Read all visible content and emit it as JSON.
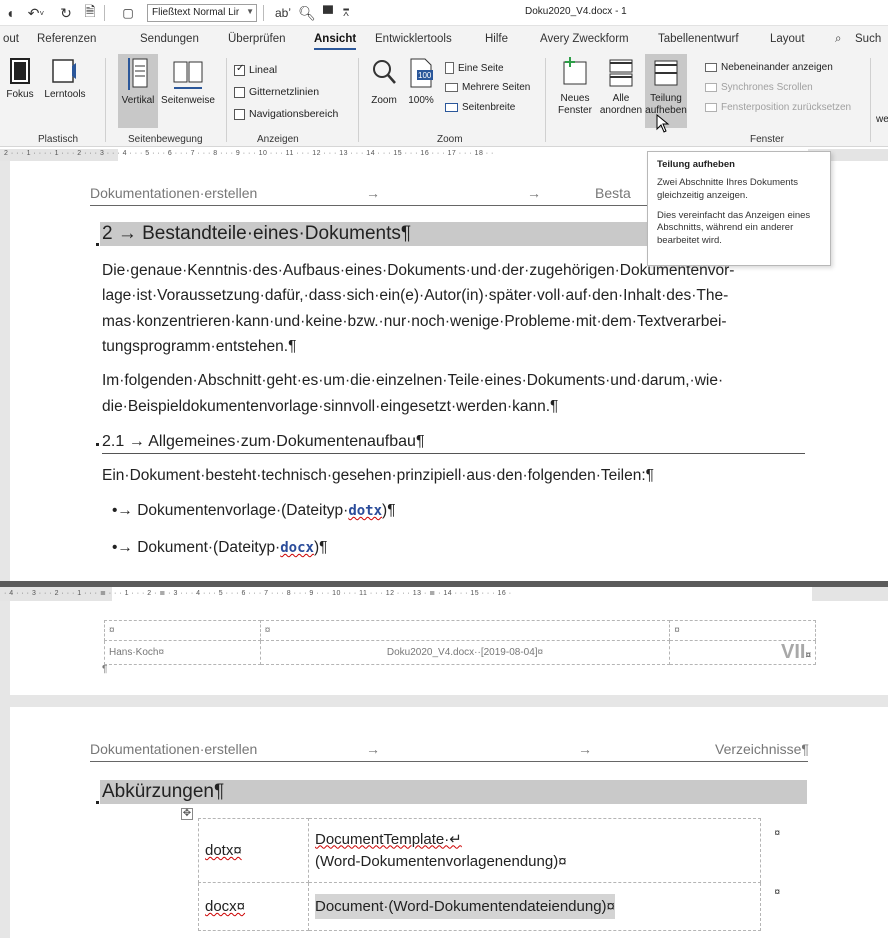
{
  "titlebar": {
    "style_name": "Fließtext Normal Lir",
    "doc_title": "Doku2020_V4.docx  -  1"
  },
  "tabs": [
    "out",
    "Referenzen",
    "Sendungen",
    "Überprüfen",
    "Ansicht",
    "Entwicklertools",
    "Hilfe",
    "Avery Zweckform",
    "Tabellenentwurf",
    "Layout",
    "Such"
  ],
  "active_tab": "Ansicht",
  "ribbon": {
    "fokus": "Fokus",
    "lerntools": "Lerntools",
    "plastisch_label": "Plastisch",
    "vertikal": "Vertikal",
    "seitenweise": "Seitenweise",
    "seitenbewegung_label": "Seitenbewegung",
    "lineal": "Lineal",
    "lineal_checked": true,
    "gitternetzlinien": "Gitternetzlinien",
    "navigationsbereich": "Navigationsbereich",
    "anzeigen_label": "Anzeigen",
    "zoom": "Zoom",
    "zoom100": "100%",
    "eine_seite": "Eine Seite",
    "mehrere_seiten": "Mehrere Seiten",
    "seitenbreite": "Seitenbreite",
    "zoom_label": "Zoom",
    "neues_fenster_1": "Neues",
    "neues_fenster_2": "Fenster",
    "alle_anordnen_1": "Alle",
    "alle_anordnen_2": "anordnen",
    "teilung_1": "Teilung",
    "teilung_2": "aufheben",
    "nebeneinander": "Nebeneinander anzeigen",
    "synchrones": "Synchrones Scrollen",
    "fensterposition": "Fensterposition zurücksetzen",
    "fenster_label": "Fenster",
    "edge_text": "we"
  },
  "tooltip": {
    "title": "Teilung aufheben",
    "p1": "Zwei Abschnitte Ihres Dokuments gleichzeitig anzeigen.",
    "p2": "Dies vereinfacht das Anzeigen eines Abschnitts, während ein anderer bearbeitet wird."
  },
  "rulers": {
    "top": "2 · · · 1 · · ·      · 1 · · · 2 · · · 3 · · · 4 · · · 5 · · · 6 · · · 7 · · · 8 · · · 9 · · · 10 · · · 11 · · · 12 · · · 13 · · · 14 · · · 15 · · · 16 · · · 17 · · · 18 · ·",
    "split": "· 4 · · · 3 · · · 2 · · · 1 · · · ≣ · · · 1 · · · 2 · ≣ · 3 · · · 4 · · · 5 · · · 6 · · · 7 · · · 8 · · · 9 · · · 10 · · · 11 · · · 12 · · · 13 · ≣ · 14 · · · 15 · · · 16 ·"
  },
  "doc1": {
    "header_left": "Dokumentationen·erstellen",
    "header_arrow1": "→",
    "header_arrow2": "→",
    "header_right": "Besta",
    "h1": "2 → Bestandteile·eines·Dokuments¶",
    "para1": [
      "Die·genaue·Kenntnis·des·Aufbaus·eines·Dokuments·und·der·zugehörigen·Dokumentenvor-",
      "lage·ist·Voraussetzung·dafür,·dass·sich·ein(e)·Autor(in)·später·voll·auf·den·Inhalt·des·The-",
      "mas·konzentrieren·kann·und·keine·bzw.·nur·noch·wenige·Probleme·mit·dem·Textverarbei-",
      "tungsprogramm·entstehen.¶"
    ],
    "para2": [
      "Im·folgenden·Abschnitt·geht·es·um·die·einzelnen·Teile·eines·Dokuments·und·darum,·wie·",
      "die·Beispieldokumentenvorlage·sinnvoll·eingesetzt·werden·kann.¶"
    ],
    "h2": "2.1 → Allgemeines·zum·Dokumentenaufbau¶",
    "para3": "Ein·Dokument·besteht·technisch·gesehen·prinzipiell·aus·den·folgenden·Teilen:¶",
    "bullet1_prefix": "•→ Dokumentenvorlage·(Dateityp·",
    "bullet1_code": "dotx",
    "bullet1_suffix": ")¶",
    "bullet2_prefix": "•→ Dokument·(Dateityp·",
    "bullet2_code": "docx",
    "bullet2_suffix": ")¶"
  },
  "footer": {
    "cell_mark": "¤",
    "author": "Hans·Koch¤",
    "file": "Doku2020_V4.docx··[2019-08-04]¤",
    "page": "VII",
    "para_mark": "¶"
  },
  "doc2": {
    "header_left": "Dokumentationen·erstellen",
    "header_arrow1": "→",
    "header_arrow2": "→",
    "header_right": "Verzeichnisse¶",
    "h1": "Abkürzungen¶",
    "rows": [
      {
        "abbr": "dotx¤",
        "line1": "DocumentTemplate·↵",
        "line2": "(Word-Dokumentenvorlagenendung)¤"
      },
      {
        "abbr": "docx¤",
        "line1": "Document·(Word-Dokumentendateiendung)¤",
        "line2": ""
      }
    ],
    "end_mark": "¤"
  }
}
